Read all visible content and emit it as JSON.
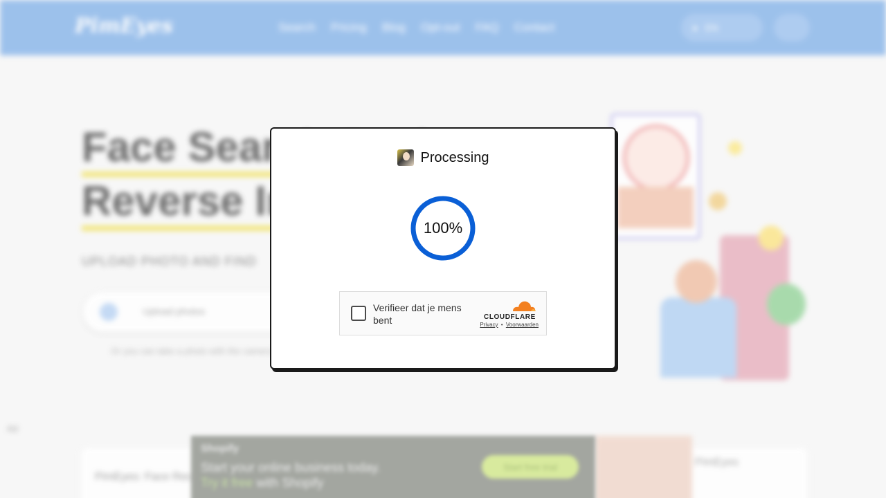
{
  "site": {
    "logo": "PimEyes",
    "nav": [
      "Search",
      "Pricing",
      "Blog",
      "Opt-out",
      "FAQ",
      "Contact"
    ],
    "lang_label": "EN",
    "hero_line1": "Face Search Engine",
    "hero_line2": "Reverse Image Search",
    "hero_sub": "UPLOAD PHOTO AND FIND",
    "search_placeholder": "Upload photos",
    "hint": "Or you can take a photo with the camera",
    "side_label": "Ad",
    "card_text": "PimEyes: Face Recognition Search",
    "card_right_text": "PimEyes"
  },
  "banner": {
    "line1": "Shopify",
    "line2": "Start your online business today.",
    "line3_em": "Try it free",
    "line3_rest": " with Shopify",
    "button": "Start free trial"
  },
  "modal": {
    "title": "Processing",
    "progress_text": "100%",
    "progress_value": 1.0,
    "ring_color": "#0a5fd6"
  },
  "captcha": {
    "label": "Verifieer dat je mens bent",
    "brand": "CLOUDFLARE",
    "privacy": "Privacy",
    "separator": "•",
    "terms": "Voorwaarden",
    "brand_color": "#f38020"
  }
}
